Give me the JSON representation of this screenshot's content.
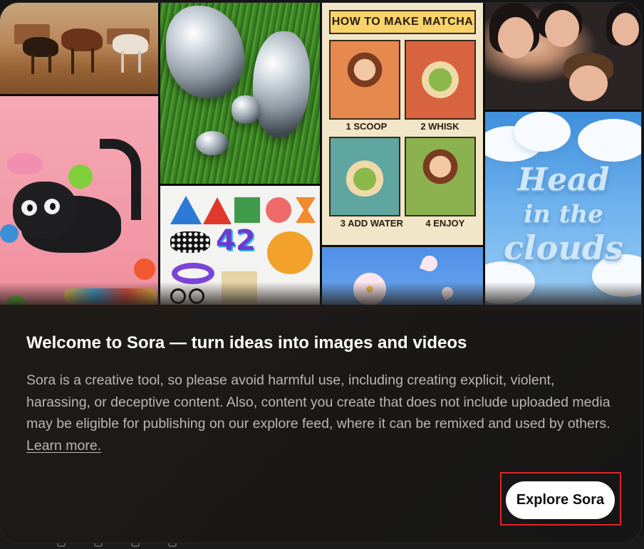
{
  "dialog": {
    "title": "Welcome to Sora — turn ideas into images and videos",
    "body_text": "Sora is a creative tool, so please avoid harmful use, including creating explicit, violent, harassing, or deceptive content. Also, content you create that does not include uploaded media may be eligible for publishing on our explore feed, where it can be remixed and used by others.",
    "learn_more_label": "Learn more.",
    "cta_label": "Explore Sora"
  },
  "mosaic": {
    "matcha_title": "HOW TO MAKE MATCHA",
    "matcha_steps": [
      "1 SCOOP",
      "2 WHISK",
      "3 ADD WATER",
      "4 ENJOY"
    ],
    "shapes_number": "42",
    "clouds_text": [
      "Head",
      "in the",
      "clouds"
    ]
  },
  "colors": {
    "cta_background": "#ffffff",
    "highlight_border": "#e0242b",
    "title_text": "#ffffff",
    "body_text": "#b9b6b3"
  }
}
